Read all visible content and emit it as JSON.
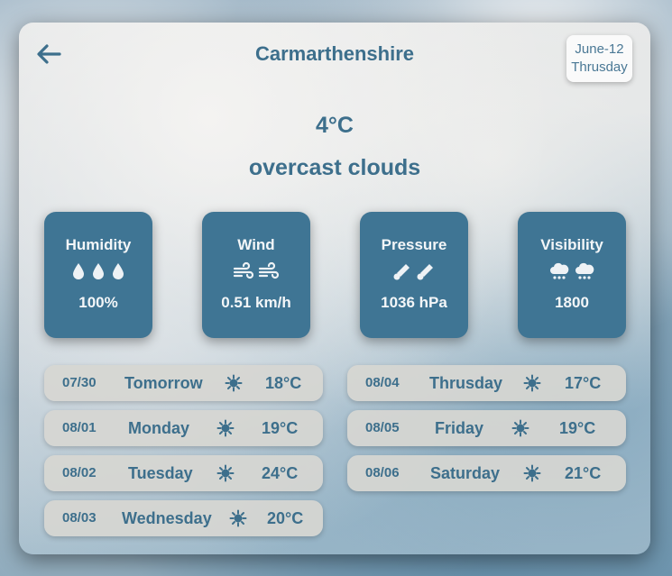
{
  "header": {
    "location": "Carmarthenshire",
    "date": "June-12",
    "weekday": "Thrusday"
  },
  "current": {
    "temperature": "4°C",
    "condition": "overcast clouds"
  },
  "stats": [
    {
      "label": "Humidity",
      "value": "100%",
      "icon": "droplet-icon"
    },
    {
      "label": "Wind",
      "value": "0.51 km/h",
      "icon": "wind-icon"
    },
    {
      "label": "Pressure",
      "value": "1036 hPa",
      "icon": "thermometer-icon"
    },
    {
      "label": "Visibility",
      "value": "1800",
      "icon": "cloud-icon"
    }
  ],
  "forecast": [
    {
      "date": "07/30",
      "day": "Tomorrow",
      "temp": "18°C",
      "icon": "sun-icon"
    },
    {
      "date": "08/01",
      "day": "Monday",
      "temp": "19°C",
      "icon": "sun-icon"
    },
    {
      "date": "08/02",
      "day": "Tuesday",
      "temp": "24°C",
      "icon": "sun-icon"
    },
    {
      "date": "08/03",
      "day": "Wednesday",
      "temp": "20°C",
      "icon": "sun-icon"
    },
    {
      "date": "08/04",
      "day": "Thrusday",
      "temp": "17°C",
      "icon": "sun-icon"
    },
    {
      "date": "08/05",
      "day": "Friday",
      "temp": "19°C",
      "icon": "sun-icon"
    },
    {
      "date": "08/06",
      "day": "Saturday",
      "temp": "21°C",
      "icon": "sun-icon"
    }
  ],
  "colors": {
    "accent": "#3d6f8c",
    "card": "#3f7594",
    "pill": "#d6d6d2"
  }
}
